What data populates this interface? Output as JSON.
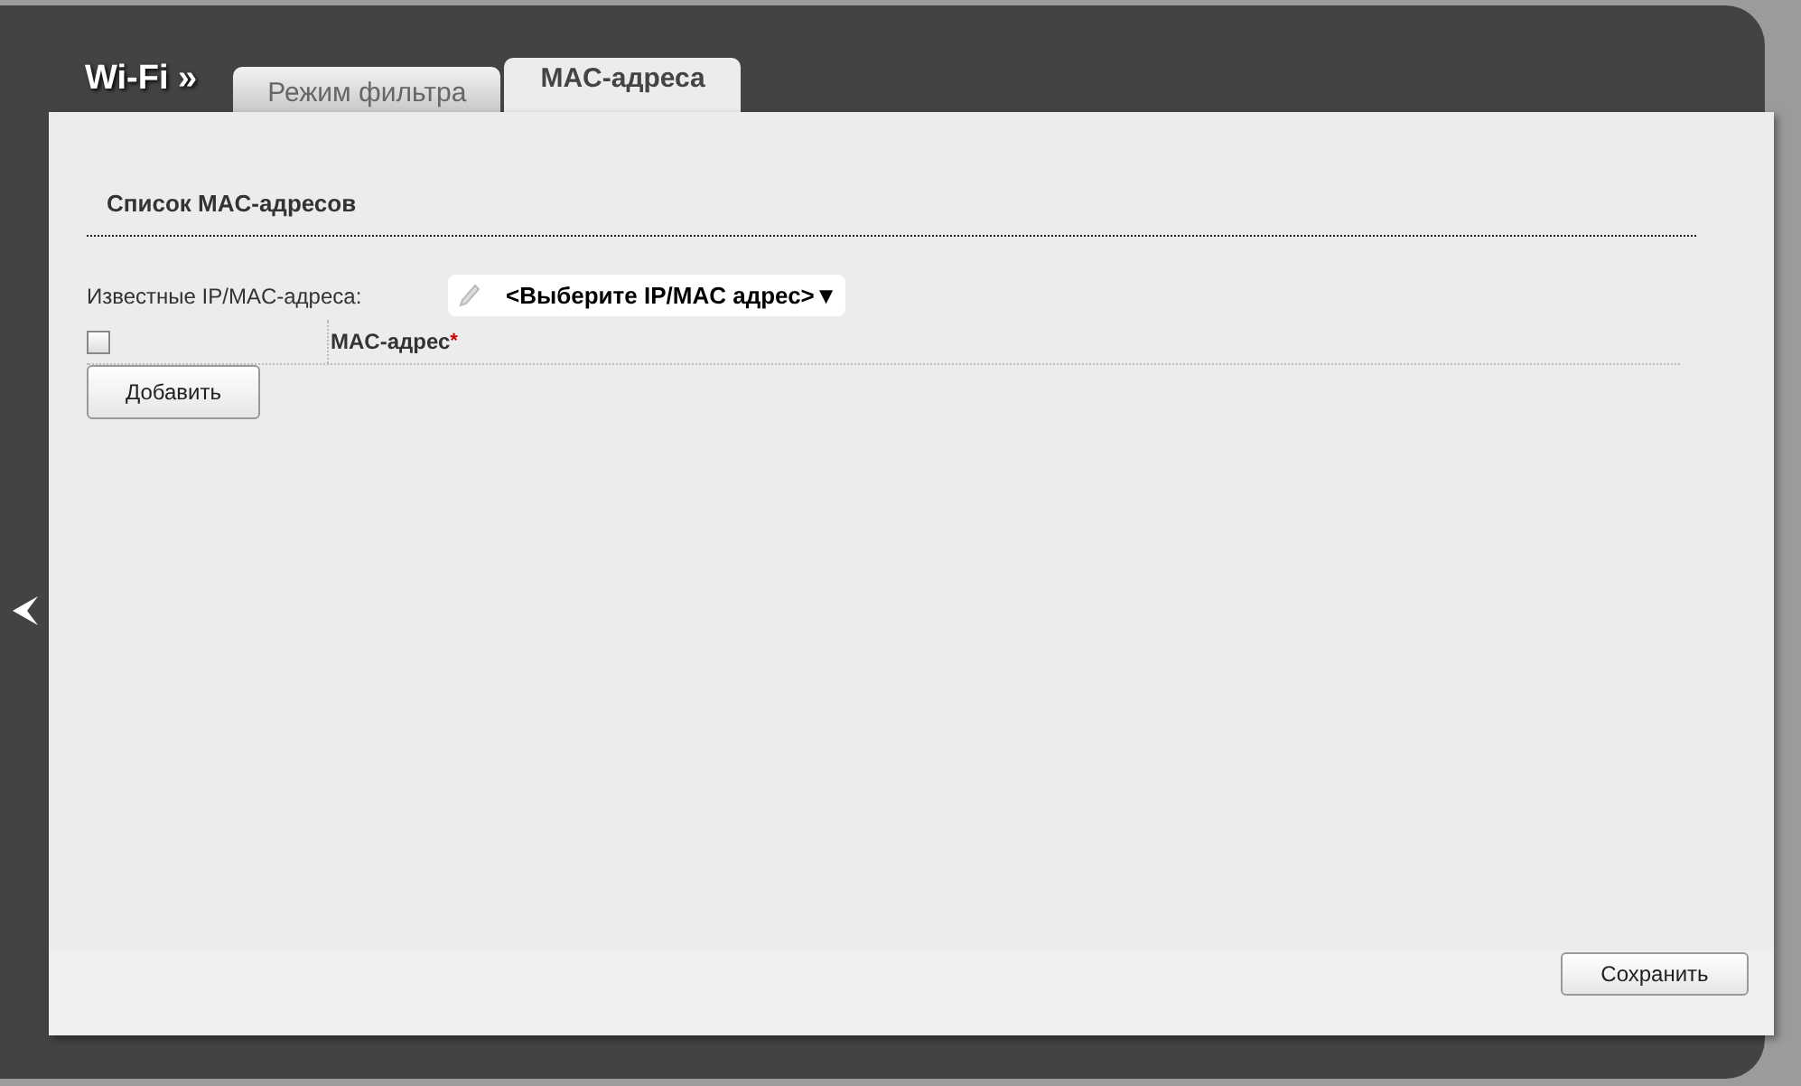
{
  "header": {
    "title": "Wi-Fi »"
  },
  "tabs": [
    {
      "label": "Режим фильтра",
      "selected": false
    },
    {
      "label": "MAC-адреса",
      "selected": true
    }
  ],
  "section": {
    "title": "Список MAC-адресов",
    "known_addresses": {
      "label": "Известные IP/MAC-адреса:",
      "value": "<Выберите IP/MAC адрес>▼"
    },
    "table": {
      "select_all": {
        "checked": false
      },
      "columns": [
        {
          "label": "MAC-адрес",
          "required_mark": "*"
        }
      ]
    },
    "add_button": "Добавить"
  },
  "footer": {
    "save_button": "Сохранить"
  }
}
